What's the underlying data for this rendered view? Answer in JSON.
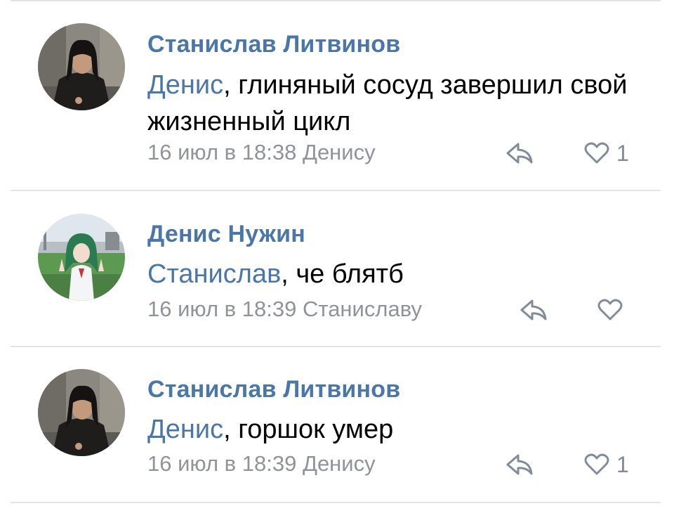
{
  "comments": [
    {
      "author": "Станислав Литвинов",
      "mention": "Денис",
      "text": ", глиняный сосуд завершил свой жизненный цикл",
      "meta": "16 июл в 18:38 Денису",
      "likes": "1",
      "avatar_icon": "man-in-dark-coat-photo"
    },
    {
      "author": "Денис Нужин",
      "mention": "Станислав",
      "text": ", че блятб",
      "meta": "16 июл в 18:39 Станиславу",
      "likes": "",
      "avatar_icon": "anime-girl-green-hair-photo"
    },
    {
      "author": "Станислав Литвинов",
      "mention": "Денис",
      "text": ", горшок умер",
      "meta": "16 июл в 18:39 Денису",
      "likes": "1",
      "avatar_icon": "man-in-dark-coat-photo"
    }
  ],
  "icons": {
    "reply": "reply-arrow-icon",
    "like": "heart-outline-icon"
  },
  "colors": {
    "link": "#4a76a8",
    "meta": "#909499",
    "icon": "#818c99",
    "divider": "#e3e4e8"
  }
}
